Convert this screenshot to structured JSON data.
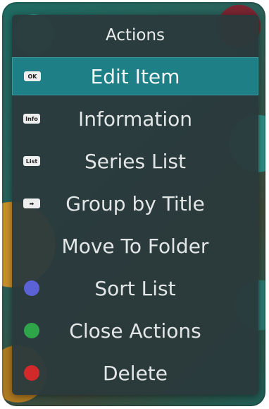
{
  "menu": {
    "title": "Actions",
    "items": [
      {
        "label": "Edit Item",
        "key": "OK",
        "selected": true
      },
      {
        "label": "Information",
        "key": "Info"
      },
      {
        "label": "Series List",
        "key": "List"
      },
      {
        "label": "Group by Title",
        "key": "➡"
      },
      {
        "label": "Move To Folder",
        "key": ""
      },
      {
        "label": "Sort List",
        "color": "#5b62d6"
      },
      {
        "label": "Close Actions",
        "color": "#2fa54a"
      },
      {
        "label": "Delete",
        "color": "#d22a2a"
      }
    ]
  }
}
